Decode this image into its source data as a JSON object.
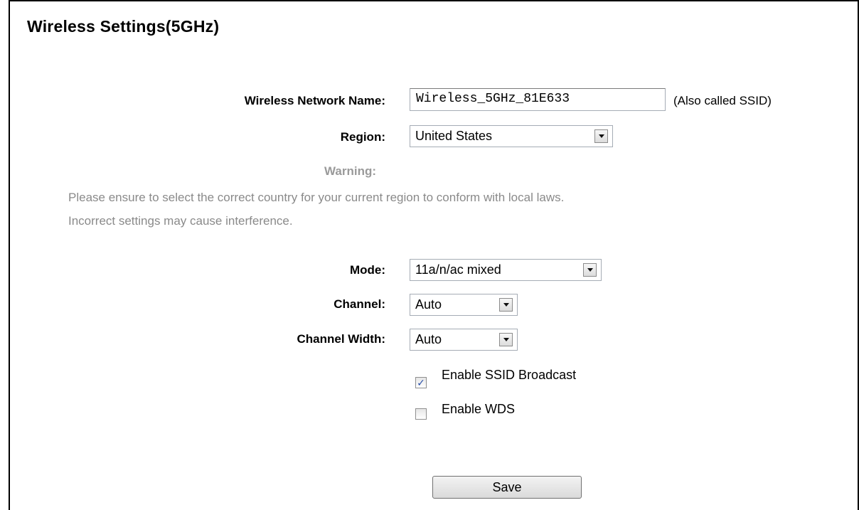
{
  "page": {
    "title": "Wireless Settings(5GHz)"
  },
  "form": {
    "ssid_label": "Wireless Network Name:",
    "ssid_value": "Wireless_5GHz_81E633",
    "ssid_hint": "(Also called SSID)",
    "region_label": "Region:",
    "region_value": "United States",
    "warning_label": "Warning:",
    "warning_line1": "Please ensure to select the correct country for your current region to conform with local laws.",
    "warning_line2": "Incorrect settings may cause interference.",
    "mode_label": "Mode:",
    "mode_value": "11a/n/ac mixed",
    "channel_label": "Channel:",
    "channel_value": "Auto",
    "channel_width_label": "Channel Width:",
    "channel_width_value": "Auto",
    "ssid_broadcast_label": "Enable SSID Broadcast",
    "ssid_broadcast_checked": true,
    "wds_label": "Enable WDS",
    "wds_checked": false,
    "save_label": "Save"
  }
}
